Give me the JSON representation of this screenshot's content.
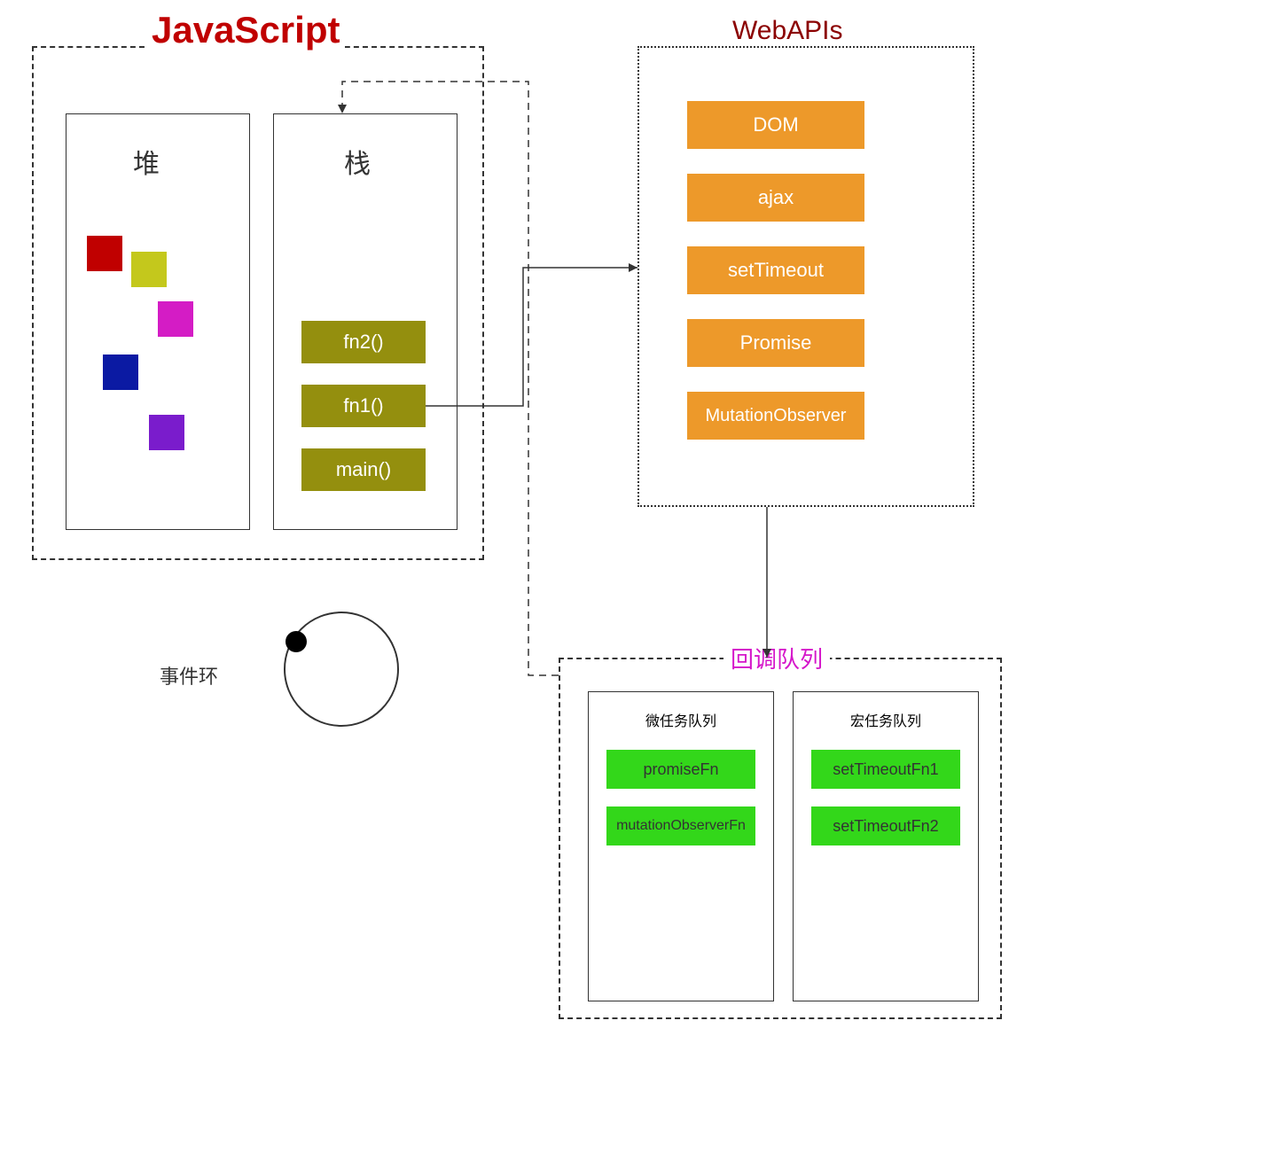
{
  "javascript": {
    "title": "JavaScript",
    "heap": {
      "title": "堆"
    },
    "stack": {
      "title": "栈",
      "items": {
        "fn2": "fn2()",
        "fn1": "fn1()",
        "main": "main()"
      }
    }
  },
  "webapis": {
    "title": "WebAPIs",
    "items": {
      "dom": "DOM",
      "ajax": "ajax",
      "setTimeout": "setTimeout",
      "promise": "Promise",
      "mutationObserver": "MutationObserver"
    }
  },
  "eventloop": {
    "label": "事件环"
  },
  "callbackQueue": {
    "title": "回调队列",
    "micro": {
      "title": "微任务队列",
      "items": {
        "promiseFn": "promiseFn",
        "mutationObserverFn": "mutationObserverFn"
      }
    },
    "macro": {
      "title": "宏任务队列",
      "items": {
        "setTimeoutFn1": "setTimeoutFn1",
        "setTimeoutFn2": "setTimeoutFn2"
      }
    }
  },
  "colors": {
    "js_title": "#c00000",
    "webapis_title": "#8b0000",
    "callback_title": "#d516ca",
    "stack_item_bg": "#948f0e",
    "api_item_bg": "#ed992a",
    "queue_item_bg": "#33d71a",
    "heap_blocks": [
      "#c00000",
      "#c4c81c",
      "#d41cc5",
      "#0b1aa3",
      "#7a1ccc"
    ]
  }
}
